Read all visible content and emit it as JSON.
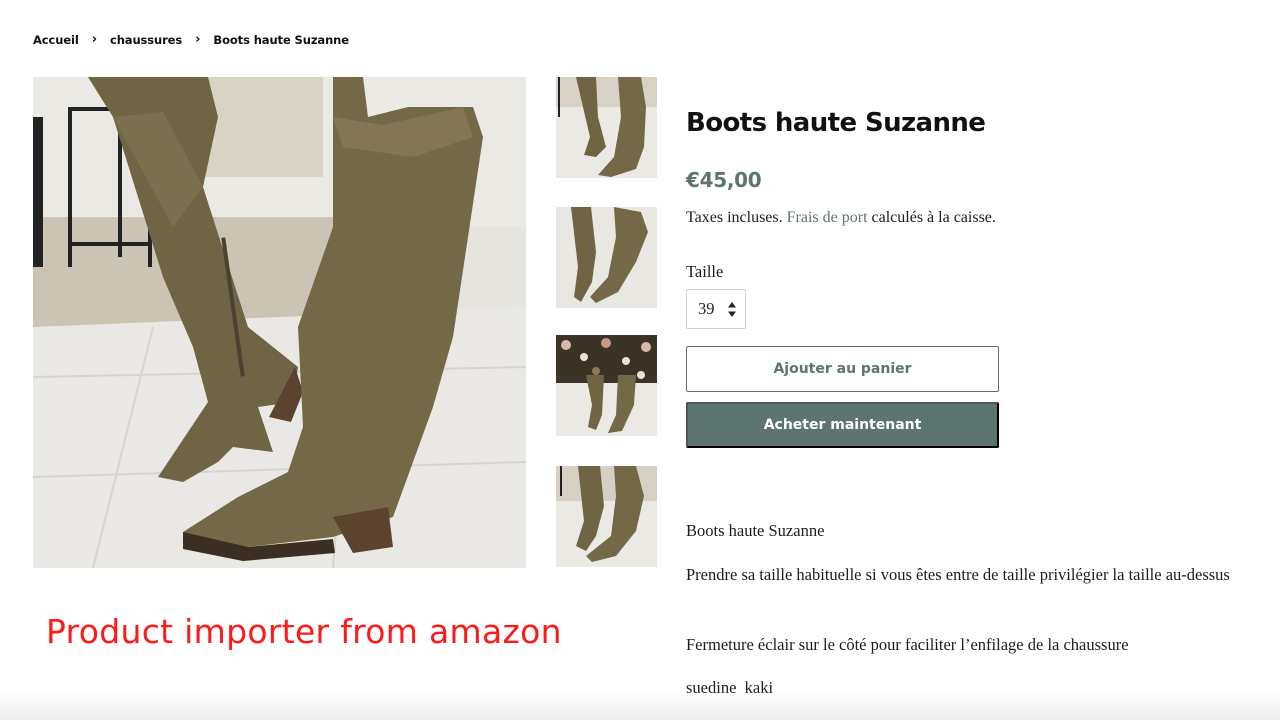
{
  "breadcrumb": {
    "home": "Accueil",
    "category": "chaussures",
    "current": "Boots haute Suzanne",
    "separator": "›"
  },
  "product": {
    "title": "Boots haute Suzanne",
    "price": "€45,00",
    "taxes_prefix": "Taxes incluses.",
    "shipping_link": "Frais de port",
    "taxes_suffix": "calculés à la caisse.",
    "size_label": "Taille",
    "size_value": "39",
    "add_to_cart": "Ajouter au panier",
    "buy_now": "Acheter maintenant"
  },
  "description": {
    "line1": "Boots haute Suzanne",
    "line2": "Prendre sa taille habituelle si vous êtes entre de taille privilégier la taille au-dessus",
    "line3": "Fermeture éclair sur le côté pour faciliter l’enfilage de la chaussure",
    "line4": "suedine  kaki"
  },
  "watermark": "Product importer from amazon",
  "colors": {
    "accent": "#5c7570",
    "watermark": "#ff1a1a",
    "boot": "#756a48"
  }
}
